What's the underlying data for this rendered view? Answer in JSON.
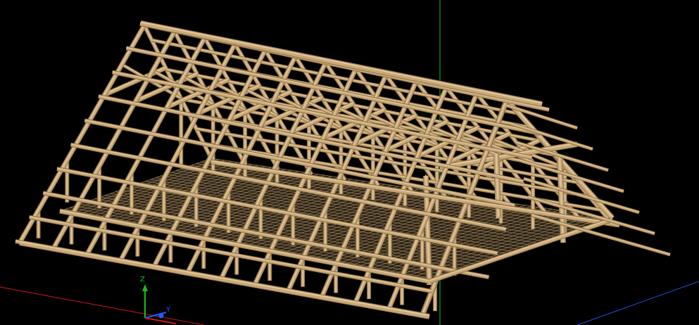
{
  "viewport": {
    "background": "#000000",
    "model": "timber-roof-truss-frame"
  },
  "axes": {
    "z_label": "Z",
    "y_label": "Y",
    "colors": {
      "x": "#d01818",
      "y": "#1f5fff",
      "z": "#18c018",
      "origin": "#1f5fff"
    }
  },
  "colors": {
    "timber": "#c8a878",
    "timber_dark": "#8c7048",
    "timber_light": "#e2c89c",
    "grid": "#b09468",
    "grid_line_green": "#18c018",
    "grid_line_red": "#d01818",
    "grid_line_blue": "#2050e0"
  },
  "structure": {
    "truss_count": 13,
    "purlin_count_per_side": 8,
    "post_rows": 2
  }
}
